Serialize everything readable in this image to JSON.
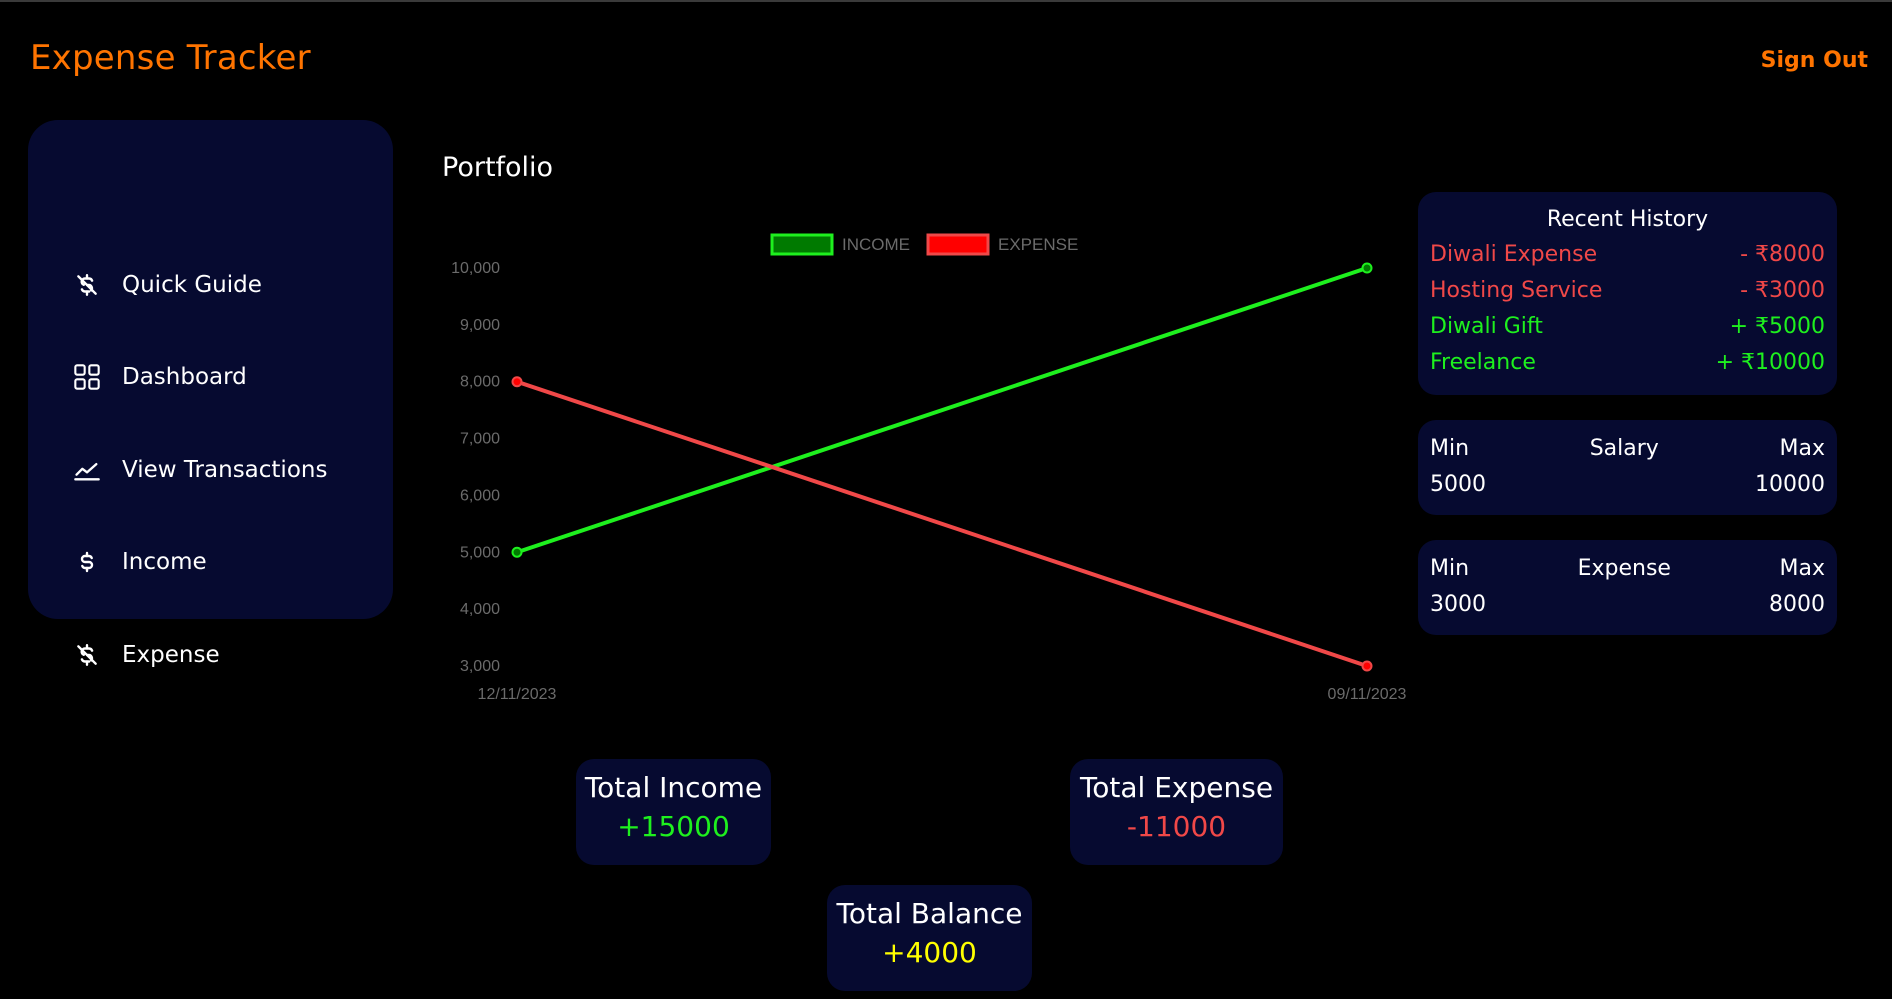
{
  "app": {
    "title": "Expense Tracker",
    "sign_out_label": "Sign Out"
  },
  "colors": {
    "accent": "#ff7400",
    "panel": "#060a30",
    "income": "#1ef01e",
    "expense": "#f04848",
    "balance": "#ffff00"
  },
  "sidebar": {
    "items": [
      {
        "label": "Quick Guide",
        "icon": "dollar-off-icon"
      },
      {
        "label": "Dashboard",
        "icon": "grid-icon"
      },
      {
        "label": "View Transactions",
        "icon": "chart-line-icon"
      },
      {
        "label": "Income",
        "icon": "dollar-icon"
      },
      {
        "label": "Expense",
        "icon": "dollar-off-icon"
      }
    ]
  },
  "main": {
    "title": "Portfolio"
  },
  "chart_data": {
    "type": "line",
    "title": "",
    "xlabel": "",
    "ylabel": "",
    "x": [
      "12/11/2023",
      "09/11/2023"
    ],
    "series": [
      {
        "name": "INCOME",
        "values": [
          5000,
          10000
        ],
        "color": "#1ef01e",
        "fill": "#007a00"
      },
      {
        "name": "EXPENSE",
        "values": [
          8000,
          3000
        ],
        "color": "#f04848",
        "fill": "#ff0000"
      }
    ],
    "ylim": [
      3000,
      10000
    ],
    "yticks": [
      "3,000",
      "4,000",
      "5,000",
      "6,000",
      "7,000",
      "8,000",
      "9,000",
      "10,000"
    ],
    "ytick_values": [
      3000,
      4000,
      5000,
      6000,
      7000,
      8000,
      9000,
      10000
    ],
    "legend": "top-center",
    "grid": false
  },
  "recent_history": {
    "title": "Recent History",
    "items": [
      {
        "name": "Diwali Expense",
        "amount": "- ₹8000",
        "type": "expense"
      },
      {
        "name": "Hosting Service",
        "amount": "- ₹3000",
        "type": "expense"
      },
      {
        "name": "Diwali Gift",
        "amount": "+ ₹5000",
        "type": "income"
      },
      {
        "name": "Freelance",
        "amount": "+ ₹10000",
        "type": "income"
      }
    ]
  },
  "salary_range": {
    "min_label": "Min",
    "title": "Salary",
    "max_label": "Max",
    "min": "5000",
    "max": "10000"
  },
  "expense_range": {
    "min_label": "Min",
    "title": "Expense",
    "max_label": "Max",
    "min": "3000",
    "max": "8000"
  },
  "totals": {
    "income": {
      "label": "Total Income",
      "value": "+15000"
    },
    "expense": {
      "label": "Total Expense",
      "value": "-11000"
    },
    "balance": {
      "label": "Total Balance",
      "value": "+4000"
    }
  }
}
